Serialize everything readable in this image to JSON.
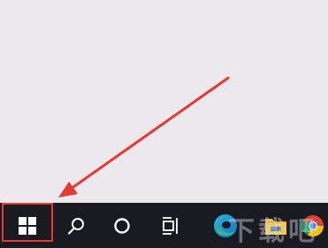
{
  "taskbar": {
    "buttons": [
      {
        "id": "start",
        "icon": "windows-logo-icon",
        "highlighted": true
      },
      {
        "id": "search",
        "icon": "search-icon"
      },
      {
        "id": "cortana",
        "icon": "cortana-circle-icon"
      },
      {
        "id": "task_view",
        "icon": "task-view-icon"
      },
      {
        "id": "edge",
        "icon": "edge-browser-icon"
      },
      {
        "id": "file_explorer",
        "icon": "folder-icon"
      },
      {
        "id": "chrome",
        "icon": "chrome-icon"
      }
    ]
  },
  "annotation": {
    "type": "arrow",
    "color": "#e53935",
    "points_to": "start"
  },
  "colors": {
    "desktop_bg": "#ebe9ec",
    "taskbar_bg": "#1a1b21",
    "icon_color": "#ffffff",
    "annotation_red": "#e53935"
  },
  "watermark": {
    "text": "下载吧"
  }
}
